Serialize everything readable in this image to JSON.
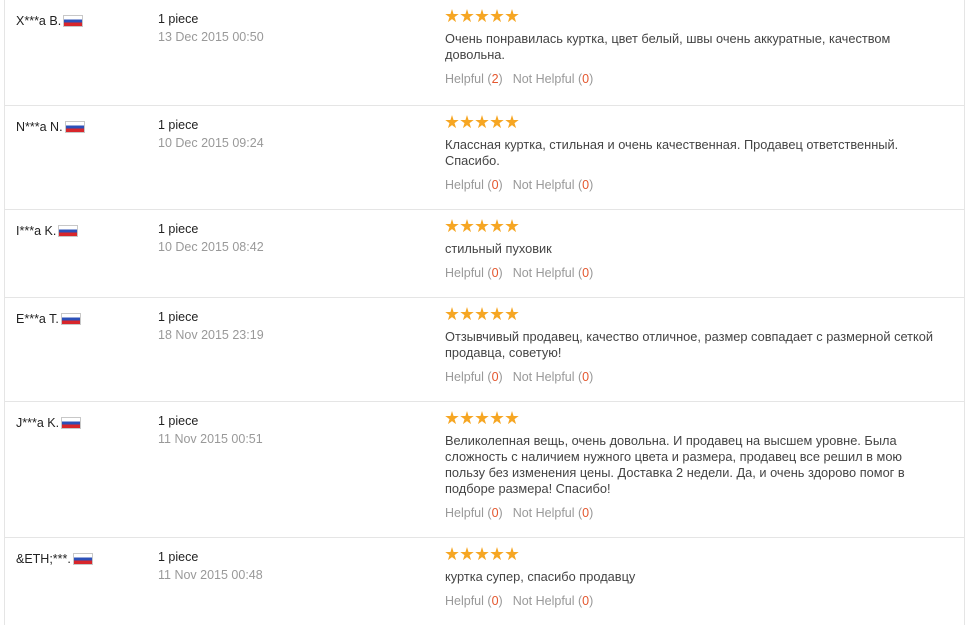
{
  "feedback": {
    "accent_color": "#f6a623",
    "count_color": "#e4572e",
    "flag_icon": "russia-flag-icon",
    "star_icon": "star-icon",
    "reviews": [
      {
        "user": "X***a B.",
        "quantity": "1 piece",
        "date": "13 Dec 2015 00:50",
        "rating": 5,
        "text": "Очень понравилась куртка, цвет белый, швы очень аккуратные, качеством довольна.",
        "helpful_label": "Helpful",
        "helpful_count": "2",
        "not_helpful_label": "Not Helpful",
        "not_helpful_count": "0"
      },
      {
        "user": "N***a N.",
        "quantity": "1 piece",
        "date": "10 Dec 2015 09:24",
        "rating": 5,
        "text": "Классная куртка, стильная и очень качественная. Продавец ответственный. Спасибо.",
        "helpful_label": "Helpful",
        "helpful_count": "0",
        "not_helpful_label": "Not Helpful",
        "not_helpful_count": "0"
      },
      {
        "user": "I***a K.",
        "quantity": "1 piece",
        "date": "10 Dec 2015 08:42",
        "rating": 5,
        "text": "стильный пуховик",
        "helpful_label": "Helpful",
        "helpful_count": "0",
        "not_helpful_label": "Not Helpful",
        "not_helpful_count": "0"
      },
      {
        "user": "E***a T.",
        "quantity": "1 piece",
        "date": "18 Nov 2015 23:19",
        "rating": 5,
        "text": "Отзывчивый продавец, качество отличное, размер совпадает с размерной сеткой продавца, советую!",
        "helpful_label": "Helpful",
        "helpful_count": "0",
        "not_helpful_label": "Not Helpful",
        "not_helpful_count": "0"
      },
      {
        "user": "J***a K.",
        "quantity": "1 piece",
        "date": "11 Nov 2015 00:51",
        "rating": 5,
        "text": "Великолепная вещь, очень довольна. И продавец на высшем уровне. Была сложность с наличием нужного цвета и размера, продавец все решил в мою пользу без изменения цены. Доставка 2 недели. Да, и очень здорово помог в подборе размера! Спасибо!",
        "helpful_label": "Helpful",
        "helpful_count": "0",
        "not_helpful_label": "Not Helpful",
        "not_helpful_count": "0"
      },
      {
        "user": "&ETH;***.",
        "quantity": "1 piece",
        "date": "11 Nov 2015 00:48",
        "rating": 5,
        "text": "куртка супер, спасибо продавцу",
        "helpful_label": "Helpful",
        "helpful_count": "0",
        "not_helpful_label": "Not Helpful",
        "not_helpful_count": "0"
      }
    ]
  }
}
